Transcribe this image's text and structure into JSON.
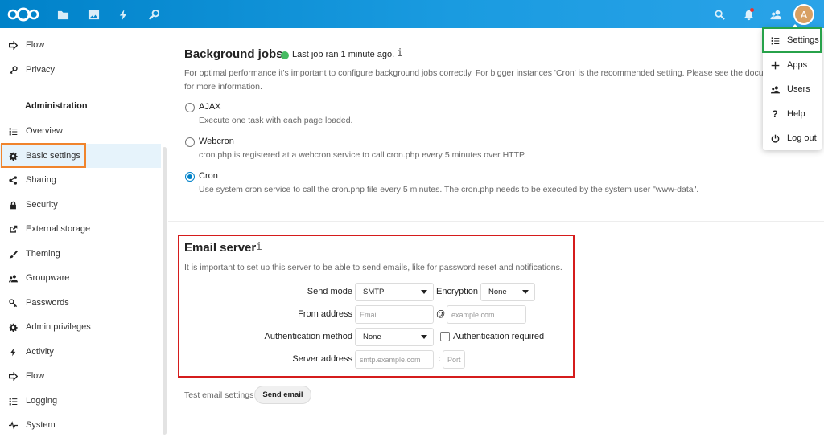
{
  "header": {
    "icons": [
      "nextcloud-logo",
      "files-icon",
      "photos-icon",
      "activity-icon",
      "search-admin-icon",
      "search-icon",
      "notifications-icon",
      "contacts-icon"
    ],
    "avatar_letter": "A",
    "color": "#0082c9"
  },
  "sidebar": {
    "items_top": [
      {
        "label": "Flow",
        "icon": "flow-icon"
      },
      {
        "label": "Privacy",
        "icon": "key-icon"
      }
    ],
    "admin_heading": "Administration",
    "items_admin": [
      {
        "label": "Overview",
        "icon": "list-icon"
      },
      {
        "label": "Basic settings",
        "icon": "gear-icon"
      },
      {
        "label": "Sharing",
        "icon": "share-icon"
      },
      {
        "label": "Security",
        "icon": "lock-icon"
      },
      {
        "label": "External storage",
        "icon": "external-icon"
      },
      {
        "label": "Theming",
        "icon": "brush-icon"
      },
      {
        "label": "Groupware",
        "icon": "group-icon"
      },
      {
        "label": "Passwords",
        "icon": "key-icon"
      },
      {
        "label": "Admin privileges",
        "icon": "gear-icon"
      },
      {
        "label": "Activity",
        "icon": "activity-icon"
      },
      {
        "label": "Flow",
        "icon": "flow-icon"
      },
      {
        "label": "Logging",
        "icon": "list-icon"
      },
      {
        "label": "System",
        "icon": "pulse-icon"
      }
    ]
  },
  "background_jobs": {
    "title": "Background jobs",
    "status": "Last job ran 1 minute ago.",
    "info": "i",
    "description_line1": "For optimal performance it's important to configure background jobs correctly. For bigger instances 'Cron' is the recommended setting. Please see the docum",
    "description_line2": "for more information.",
    "options": [
      {
        "label": "AJAX",
        "desc": "Execute one task with each page loaded.",
        "selected": false
      },
      {
        "label": "Webcron",
        "desc": "cron.php is registered at a webcron service to call cron.php every 5 minutes over HTTP.",
        "selected": false
      },
      {
        "label": "Cron",
        "desc": "Use system cron service to call the cron.php file every 5 minutes. The cron.php needs to be executed by the system user \"www-data\".",
        "selected": true
      }
    ]
  },
  "email_server": {
    "title": "Email server",
    "info": "i",
    "description": "It is important to set up this server to be able to send emails, like for password reset and notifications.",
    "send_mode_label": "Send mode",
    "send_mode_value": "SMTP",
    "encryption_label": "Encryption",
    "encryption_value": "None",
    "from_address_label": "From address",
    "from_placeholder": "Email",
    "at_sign": "@",
    "domain_placeholder": "example.com",
    "auth_method_label": "Authentication method",
    "auth_method_value": "None",
    "auth_required_label": "Authentication required",
    "server_address_label": "Server address",
    "server_placeholder": "smtp.example.com",
    "colon": ":",
    "port_placeholder": "Port",
    "test_label": "Test email settings",
    "send_button": "Send email"
  },
  "user_menu": {
    "items": [
      {
        "label": "Settings",
        "icon": "settings-list-icon"
      },
      {
        "label": "Apps",
        "icon": "plus-icon"
      },
      {
        "label": "Users",
        "icon": "users-icon"
      },
      {
        "label": "Help",
        "icon": "help-icon"
      },
      {
        "label": "Log out",
        "icon": "power-icon"
      }
    ]
  },
  "highlights": {
    "orange": "#f0842c",
    "red": "#d51c1c",
    "green": "#27a24a"
  }
}
